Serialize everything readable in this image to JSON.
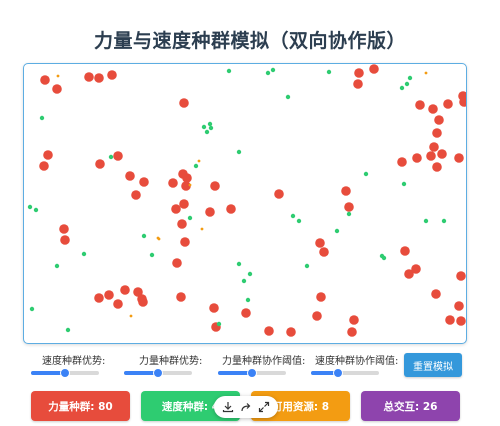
{
  "title": "力量与速度种群模拟（双向协作版）",
  "controls": [
    {
      "label": "速度种群优势:",
      "value": 0.5
    },
    {
      "label": "力量种群优势:",
      "value": 0.5
    },
    {
      "label": "力量种群协作阈值:",
      "value": 0.5
    },
    {
      "label": "速度种群协作阈值:",
      "value": 0.4
    }
  ],
  "reset_label": "重置模拟",
  "stats": {
    "force": "力量种群: 80",
    "speed": "速度种群: 4",
    "resources": "可用资源: 8",
    "interactions": "总交互: 26"
  },
  "colors": {
    "force": "#e74c3c",
    "speed": "#2ecc71",
    "resource": "#f39c12",
    "interactions": "#8e44ad",
    "accent": "#3498db"
  },
  "toolbar_icons": [
    "download-icon",
    "share-icon",
    "expand-icon"
  ]
}
